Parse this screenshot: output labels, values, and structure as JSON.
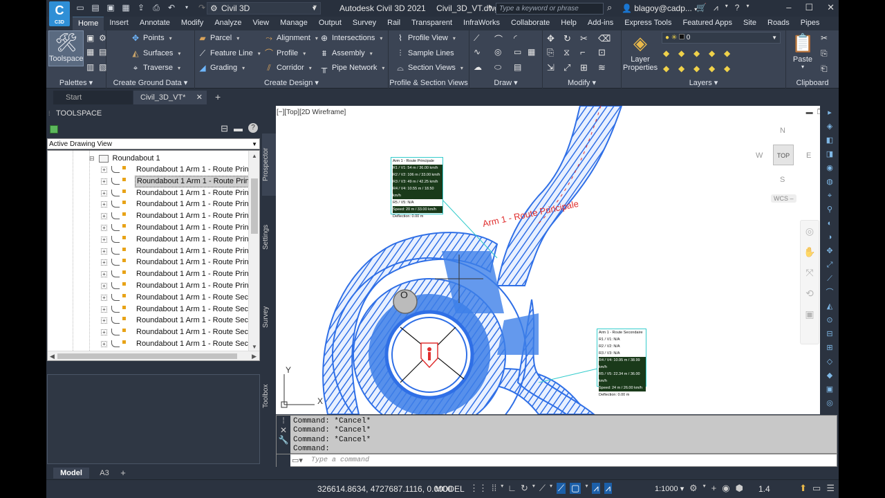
{
  "app": {
    "logo_text": "C",
    "logo_sub": "C3D",
    "workspace": "Civil 3D",
    "product": "Autodesk Civil 3D 2021",
    "filename": "Civil_3D_VT.dwg",
    "search_placeholder": "Type a keyword or phrase",
    "user": "blagoy@cadp..."
  },
  "menu_tabs": [
    "Home",
    "Insert",
    "Annotate",
    "Modify",
    "Analyze",
    "View",
    "Manage",
    "Output",
    "Survey",
    "Rail",
    "Transparent",
    "InfraWorks",
    "Collaborate",
    "Help",
    "Add-ins",
    "Express Tools",
    "Featured Apps",
    "Site",
    "Roads",
    "Pipes"
  ],
  "ribbon": {
    "palettes": {
      "title": "Palettes",
      "toolspace": "Toolspace"
    },
    "ground": {
      "title": "Create Ground Data",
      "points": "Points",
      "surfaces": "Surfaces",
      "traverse": "Traverse"
    },
    "design": {
      "title": "Create Design",
      "parcel": "Parcel",
      "feature_line": "Feature Line",
      "grading": "Grading",
      "alignment": "Alignment",
      "profile": "Profile",
      "corridor": "Corridor",
      "intersections": "Intersections",
      "assembly": "Assembly",
      "pipe_network": "Pipe Network"
    },
    "profile_section": {
      "title": "Profile & Section Views",
      "profile_view": "Profile View",
      "sample_lines": "Sample Lines",
      "section_views": "Section Views"
    },
    "draw": {
      "title": "Draw"
    },
    "modify": {
      "title": "Modify"
    },
    "layers": {
      "title": "Layers",
      "layer_properties_1": "Layer",
      "layer_properties_2": "Properties",
      "current_layer": "0"
    },
    "clipboard": {
      "title": "Clipboard",
      "paste": "Paste"
    }
  },
  "doc_tabs": {
    "start": "Start",
    "drawing": "Civil_3D_VT*"
  },
  "toolspace": {
    "title": "TOOLSPACE",
    "view_select": "Active Drawing View",
    "tree_root": "Roundabout 1",
    "items": [
      "Roundabout 1 Arm 1 - Route Princ...",
      "Roundabout 1 Arm 1 - Route Princ...",
      "Roundabout 1 Arm 1 - Route Princ...",
      "Roundabout 1 Arm 1 - Route Princ...",
      "Roundabout 1 Arm 1 - Route Princ...",
      "Roundabout 1 Arm 1 - Route Princ...",
      "Roundabout 1 Arm 1 - Route Princ...",
      "Roundabout 1 Arm 1 - Route Princ...",
      "Roundabout 1 Arm 1 - Route Princ...",
      "Roundabout 1 Arm 1 - Route Princ...",
      "Roundabout 1 Arm 1 - Route Princ...",
      "Roundabout 1 Arm 1 - Route Seco...",
      "Roundabout 1 Arm 1 - Route Seco...",
      "Roundabout 1 Arm 1 - Route Seco...",
      "Roundabout 1 Arm 1 - Route Seco...",
      "Roundabout 1 Arm 1 - Route Seco...",
      "Roundabout 1 Arm 1 - Route Seco..."
    ],
    "vertical_tabs": [
      "Prospector",
      "Settings",
      "Survey",
      "Toolbox"
    ]
  },
  "viewport": {
    "label": "[−][Top][2D Wireframe]",
    "cube_top": "TOP",
    "n": "N",
    "s": "S",
    "e": "E",
    "w": "W",
    "wcs": "WCS –",
    "ucs_x": "X",
    "ucs_y": "Y",
    "table1_title": "Arm 1 - Route Principale",
    "table1_rows": [
      "R1 / V1: 54 m / 36.00 km/h",
      "R2 / V2: 106 m / 33.00 km/h",
      "R3 / V3: 49 m / 42.25 km/h",
      "R4 / V4: 10.55 m / 18.50 km/h",
      "R5 / V5: N/A",
      "Speed: 20 m / 33.00 km/h",
      "Deflection: 0.00 m"
    ],
    "table2_title": "Arm 1 - Route Secondaire",
    "table2_rows": [
      "R1 / V1: N/A",
      "R2 / V2: N/A",
      "R3 / V3: N/A",
      "R4 / V4: 10.95 m / 38.99 km/h",
      "R5 / V5: 22.34 m / 36.00 km/h",
      "Speed: 24 m / 26.00 km/h",
      "Deflection: 0.00 m"
    ],
    "arm_label": "Arm 1 - Route Principale",
    "colors": {
      "road": "#2f6fe6",
      "fill": "#3d7fe8",
      "annotation": "#e03030",
      "label_box": "#33cccc"
    }
  },
  "command": {
    "history": [
      "Command: *Cancel*",
      "Command: *Cancel*",
      "Command: *Cancel*",
      "Command:"
    ],
    "placeholder": "Type a command"
  },
  "layout_tabs": {
    "model": "Model",
    "a3": "A3",
    "plus": "+"
  },
  "status": {
    "coords": "326614.8634, 4727687.1116, 0.0000",
    "model": "MODEL",
    "scale": "1:1000",
    "annotation_scale": "1.4"
  }
}
